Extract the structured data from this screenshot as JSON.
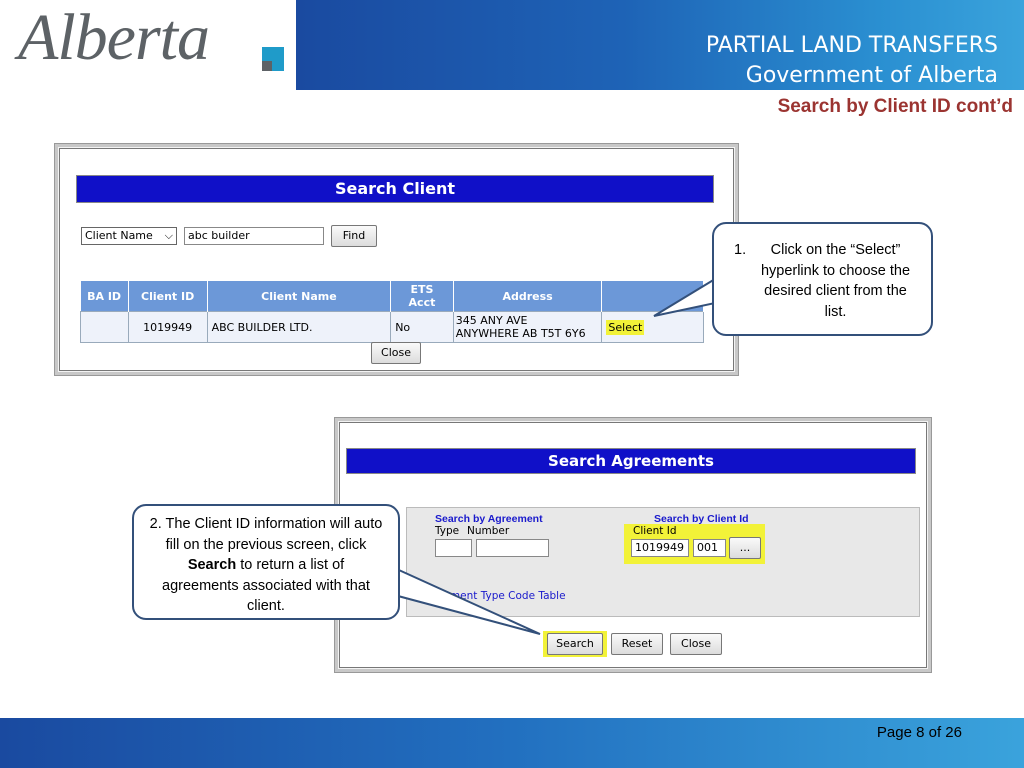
{
  "header": {
    "logo_text": "Alberta",
    "title_line1": "PARTIAL LAND TRANSFERS",
    "title_line2": "Government of Alberta",
    "subtitle": "Search by Client ID cont’d"
  },
  "search_client": {
    "heading": "Search Client",
    "criteria_select": "Client Name",
    "search_value": "abc builder",
    "find_label": "Find",
    "columns": [
      "BA ID",
      "Client ID",
      "Client Name",
      "ETS Acct",
      "Address",
      ""
    ],
    "rows": [
      {
        "ba_id": "",
        "client_id": "1019949",
        "client_name": "ABC BUILDER LTD.",
        "ets_acct": "No",
        "address_line1": "345 ANY AVE",
        "address_line2": "ANYWHERE AB T5T 6Y6",
        "action": "Select"
      }
    ],
    "close_label": "Close"
  },
  "callout1": {
    "number": "1.",
    "text": "Click on the “Select” hyperlink to choose the desired client from the list."
  },
  "search_agreements": {
    "heading": "Search Agreements",
    "by_agreement_label": "Search by Agreement",
    "type_label": "Type",
    "number_label": "Number",
    "type_value": "",
    "number_value": "",
    "by_client_label": "Search by Client Id",
    "client_id_label": "Client Id",
    "client_id_value": "1019949",
    "client_suffix_value": "001",
    "lookup_label": "...",
    "code_table_link": "eement Type Code Table",
    "search_label": "Search",
    "reset_label": "Reset",
    "close_label": "Close"
  },
  "callout2": {
    "text_before": "2. The Client ID information will auto fill on the previous screen, click ",
    "text_bold": "Search",
    "text_after": " to return a list of agreements associated with that client."
  },
  "footer": {
    "page_text": "Page 8 of 26"
  },
  "colors": {
    "banner": "#1e63b6",
    "subtitle": "#9b3431",
    "highlight": "#f2f238",
    "callout_border": "#33507a"
  }
}
